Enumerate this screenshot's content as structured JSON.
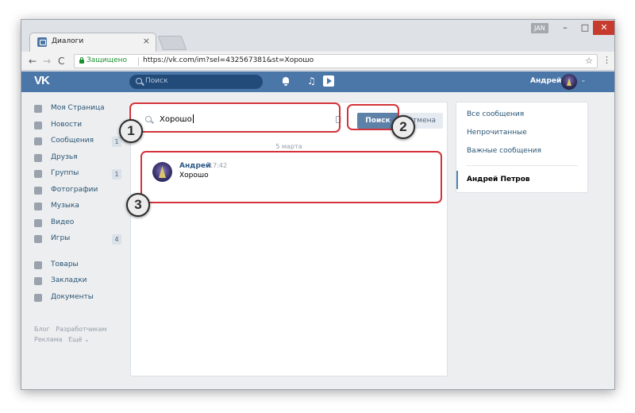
{
  "browser": {
    "tab_title": "Диалоги",
    "tab_close": "×",
    "user_badge": "JAN",
    "window_min": "–",
    "window_max": "□",
    "window_close": "✕",
    "nav_back": "←",
    "nav_forward": "→",
    "nav_reload": "C",
    "secure_label": "Защищено",
    "url": "https://vk.com/im?sel=432567381&st=Хорошо",
    "bookmark_star": "☆",
    "menu_dots": "⋮"
  },
  "vk_header": {
    "logo": "VK",
    "search_placeholder": "Поиск",
    "music_glyph": "♫",
    "user_name": "Андрей",
    "chevron": "⌄"
  },
  "left_nav": {
    "items": [
      {
        "label": "Моя Страница",
        "icon": "home-icon"
      },
      {
        "label": "Новости",
        "icon": "news-icon"
      },
      {
        "label": "Сообщения",
        "icon": "messages-icon",
        "badge": "1"
      },
      {
        "label": "Друзья",
        "icon": "friends-icon"
      },
      {
        "label": "Группы",
        "icon": "groups-icon",
        "badge": "1"
      },
      {
        "label": "Фотографии",
        "icon": "photo-icon"
      },
      {
        "label": "Музыка",
        "icon": "music-icon"
      },
      {
        "label": "Видео",
        "icon": "video-icon"
      },
      {
        "label": "Игры",
        "icon": "games-icon",
        "badge": "4"
      }
    ],
    "items2": [
      {
        "label": "Товары",
        "icon": "bag-icon"
      },
      {
        "label": "Закладки",
        "icon": "star-icon"
      },
      {
        "label": "Документы",
        "icon": "document-icon"
      }
    ],
    "footer": {
      "blog": "Блог",
      "developers": "Разработчикам",
      "ads": "Реклама",
      "more": "Ещё ⌄"
    }
  },
  "search": {
    "value": "Хорошо",
    "search_button": "Поиск",
    "cancel_button": "Отмена"
  },
  "results": {
    "date_separator": "5 марта",
    "message": {
      "author": "Андрей",
      "time": "17:42",
      "text": "Хорошо"
    }
  },
  "right_nav": {
    "items": [
      "Все сообщения",
      "Непрочитанные",
      "Важные сообщения"
    ],
    "active_dialog": "Андрей Петров"
  },
  "annotations": {
    "step1": "1",
    "step2": "2",
    "step3": "3",
    "highlight_color": "#d3333b"
  },
  "colors": {
    "vk_blue": "#4a76a8",
    "button_blue": "#5e81a8",
    "link_blue": "#2a5885"
  }
}
